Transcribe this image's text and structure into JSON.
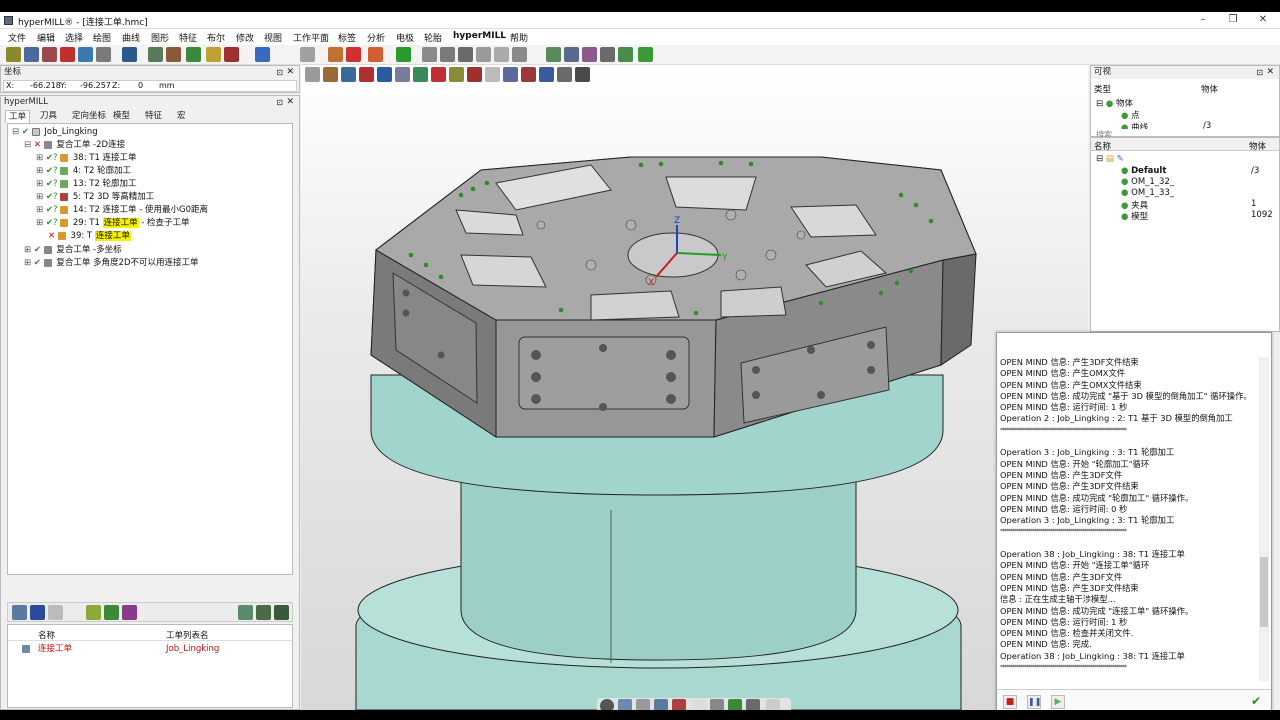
{
  "window": {
    "title": "hyperMILL® - [连接工单.hmc]",
    "min": "–",
    "max": "❐",
    "close": "✕"
  },
  "menu": [
    "文件",
    "编辑",
    "选择",
    "绘图",
    "曲线",
    "图形",
    "特征",
    "布尔",
    "修改",
    "视图",
    "工作平面",
    "标签",
    "分析",
    "电极",
    "轮胎",
    "hyperMILL",
    "帮助"
  ],
  "coords": {
    "panel_title": "坐标",
    "x_label": "X:",
    "x": "-66.218",
    "y_label": "Y:",
    "y": "-96.257",
    "z_label": "Z:",
    "z": "0",
    "unit": "mm"
  },
  "hypermill": {
    "panel_title": "hyperMILL",
    "tabs": [
      "工单",
      "刀具",
      "定向坐标",
      "模型",
      "特征",
      "宏"
    ],
    "tree": [
      {
        "label": "Job_Lingking",
        "level": 0,
        "mark": "✔",
        "color": "#2a8a2a"
      },
      {
        "label": "复合工单 -2D连接",
        "level": 1,
        "mark": "✕",
        "color": "#d01010"
      },
      {
        "label": "38: T1 连接工单",
        "level": 2,
        "mark": "✔?",
        "color": "#2a8a2a"
      },
      {
        "label": "4: T2 轮廓加工",
        "level": 2,
        "mark": "✔?",
        "color": "#2a8a2a"
      },
      {
        "label": "13: T2 轮廓加工",
        "level": 2,
        "mark": "✔?",
        "color": "#2a8a2a"
      },
      {
        "label": "5: T2 3D 等高精加工",
        "level": 2,
        "mark": "✔?",
        "color": "#2a8a2a"
      },
      {
        "label": "14: T2 连接工单 - 使用最小G0距离",
        "level": 2,
        "mark": "✔?",
        "color": "#2a8a2a"
      },
      {
        "label_pre": "29: T1 ",
        "label_hl": "连接工单",
        "label_post": " - 检查子工单",
        "level": 2,
        "mark": "✔?",
        "color": "#2a8a2a"
      },
      {
        "label_pre": "39: T ",
        "label_hl": "连接工单",
        "label_post": "",
        "level": 2,
        "mark": "✕",
        "color": "#d01010"
      },
      {
        "label": "复合工单 -多坐标",
        "level": 1,
        "mark": "✔",
        "color": "#2a8a2a"
      },
      {
        "label": "复合工单 多角度2D不可以用连接工单",
        "level": 1,
        "mark": "✔",
        "color": "#2a8a2a"
      }
    ],
    "list_headers": [
      "名称",
      "工单列表名"
    ],
    "list_row": {
      "name": "连接工单",
      "job": "Job_Lingking"
    }
  },
  "visible_panel": {
    "title": "可视",
    "headers": [
      "类型",
      "物体"
    ],
    "items": [
      "物体",
      "点",
      "曲线"
    ],
    "count": "/3",
    "search_label": "搜索"
  },
  "layers_panel": {
    "headers": [
      "名称",
      "物体"
    ],
    "rows": [
      {
        "name": "Default",
        "count": "/3",
        "bold": true
      },
      {
        "name": "OM_1_32_",
        "count": ""
      },
      {
        "name": "OM_1_33_",
        "count": ""
      },
      {
        "name": "夹具",
        "count": "1"
      },
      {
        "name": "模型",
        "count": "1092"
      }
    ]
  },
  "log": {
    "lines": [
      "OPEN MIND 信息:     产生3DF文件结束",
      "OPEN MIND 信息:     产生OMX文件",
      "OPEN MIND 信息:     产生OMX文件结束",
      "OPEN MIND 信息:     成功完成 \"基于 3D 模型的倒角加工\" 循环操作。",
      "OPEN MIND 信息:     运行时间: 1 秒",
      "Operation 2 : Job_Lingking :  2: T1 基于 3D 模型的倒角加工",
      "***************************************************************",
      "",
      "Operation 3 : Job_Lingking :  3: T1 轮廓加工",
      "OPEN MIND 信息:     开始 \"轮廓加工\"循环",
      "OPEN MIND 信息:     产生3DF文件",
      "OPEN MIND 信息:     产生3DF文件结束",
      "OPEN MIND 信息:     成功完成 \"轮廓加工\" 循环操作。",
      "OPEN MIND 信息:     运行时间: 0 秒",
      "Operation 3 : Job_Lingking :  3: T1 轮廓加工",
      "***************************************************************",
      "",
      "Operation 38 : Job_Lingking :  38: T1 连接工单",
      "OPEN MIND 信息:     开始 \"连接工单\"循环",
      "OPEN MIND 信息:     产生3DF文件",
      "OPEN MIND 信息:     产生3DF文件结束",
      "信息 : 正在生成主轴干涉模型...",
      "OPEN MIND 信息:     成功完成 \"连接工单\" 循环操作。",
      "OPEN MIND 信息:     运行时间: 1 秒",
      "OPEN MIND 信息:     检查并关闭文件.",
      "OPEN MIND 信息:     完成.",
      "Operation 38 : Job_Lingking :  38: T1 连接工单",
      "***************************************************************"
    ]
  },
  "axis": {
    "x": "X",
    "y": "Y",
    "z": "Z"
  },
  "colors": {
    "highlight": "#f5f200",
    "model_gray": "#8e8e8e",
    "cylinder": "#a8d8d0",
    "hole_green": "#2e8b2e"
  }
}
